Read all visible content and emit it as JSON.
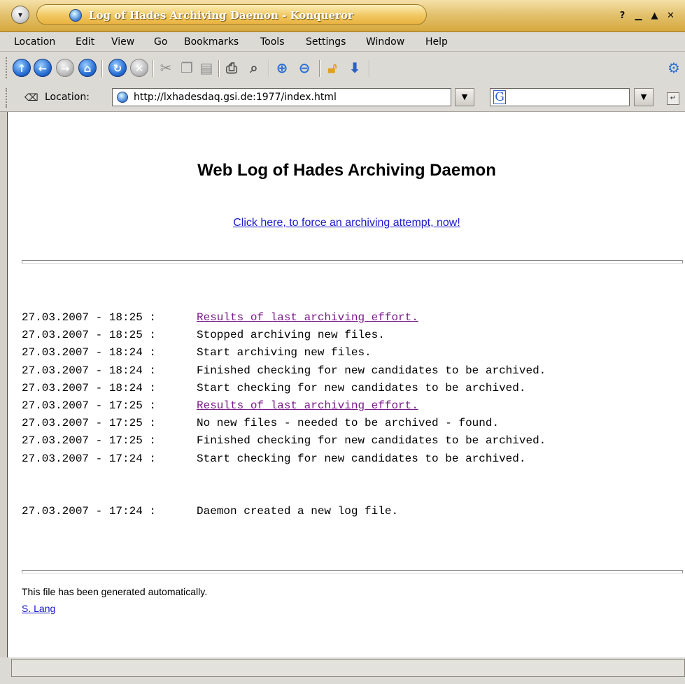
{
  "window": {
    "title": "Log of Hades Archiving Daemon - Konqueror",
    "controls": {
      "help": "?",
      "minimize": "▁",
      "maximize": "▲",
      "close": "✕"
    }
  },
  "menubar": {
    "items": [
      "Location",
      "Edit",
      "View",
      "Go",
      "Bookmarks",
      "Tools",
      "Settings",
      "Window",
      "Help"
    ]
  },
  "toolbar": {
    "icons": [
      "up-arrow-icon",
      "back-arrow-icon",
      "forward-arrow-icon",
      "home-icon",
      "reload-icon",
      "stop-icon",
      "cut-icon",
      "copy-icon",
      "paste-icon",
      "print-icon",
      "find-icon",
      "zoom-in-icon",
      "zoom-out-icon",
      "security-lock-icon",
      "download-icon",
      "konqueror-gear-icon"
    ]
  },
  "location_bar": {
    "label": "Location:",
    "url": "http://lxhadesdaq.gsi.de:1977/index.html",
    "search_engine_glyph": "G",
    "search_value": ""
  },
  "page": {
    "heading": "Web Log of Hades Archiving Daemon",
    "force_link": "Click here, to force an archiving attempt, now!",
    "log_entries": [
      {
        "timestamp": "27.03.2007 - 18:25 :",
        "message": "Results of last archiving effort.",
        "link": true
      },
      {
        "timestamp": "27.03.2007 - 18:25 :",
        "message": "Stopped archiving new files.",
        "link": false
      },
      {
        "timestamp": "27.03.2007 - 18:24 :",
        "message": "Start archiving new files.",
        "link": false
      },
      {
        "timestamp": "27.03.2007 - 18:24 :",
        "message": "Finished checking for new candidates to be archived.",
        "link": false
      },
      {
        "timestamp": "27.03.2007 - 18:24 :",
        "message": "Start checking for new candidates to be archived.",
        "link": false
      },
      {
        "timestamp": "27.03.2007 - 17:25 :",
        "message": "Results of last archiving effort.",
        "link": true
      },
      {
        "timestamp": "27.03.2007 - 17:25 :",
        "message": "No new files - needed to be archived - found.",
        "link": false
      },
      {
        "timestamp": "27.03.2007 - 17:25 :",
        "message": "Finished checking for new candidates to be archived.",
        "link": false
      },
      {
        "timestamp": "27.03.2007 - 17:24 :",
        "message": "Start checking for new candidates to be archived.",
        "link": false
      },
      {
        "timestamp": "",
        "message": "",
        "link": false
      },
      {
        "timestamp": "",
        "message": "",
        "link": false
      },
      {
        "timestamp": "27.03.2007 - 17:24 :",
        "message": "Daemon created a new log file.",
        "link": false
      }
    ],
    "footer_note": "This file has been generated automatically.",
    "author_link": "S. Lang"
  },
  "colors": {
    "titlebar": "#e2c06a",
    "link": "#1a1acc",
    "visited_link": "#7a1a8a"
  }
}
